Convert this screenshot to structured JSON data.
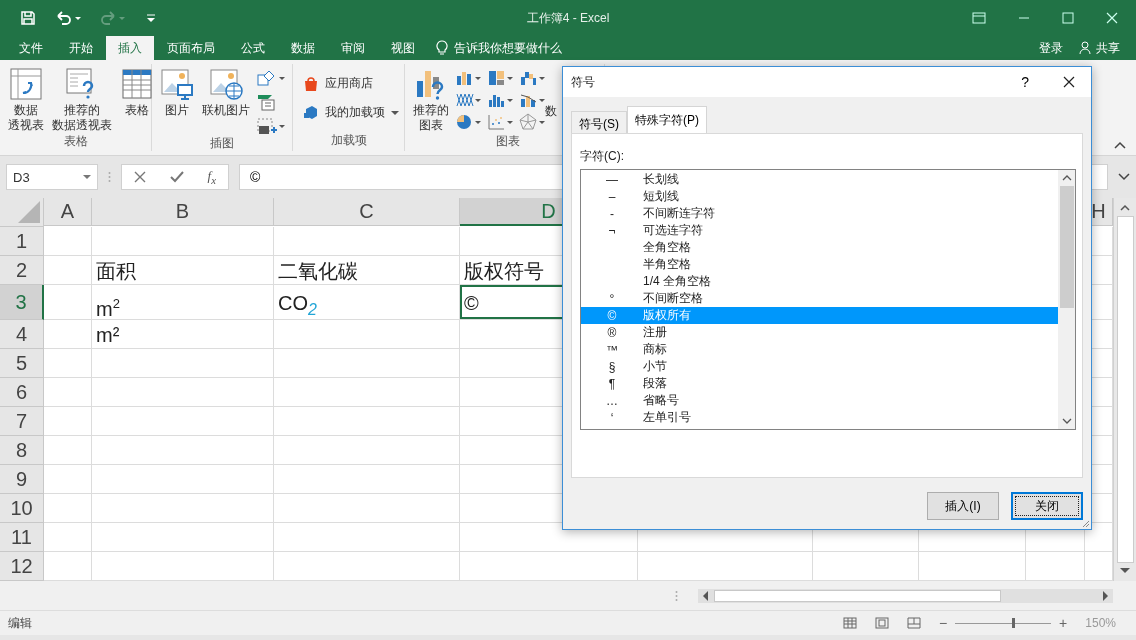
{
  "title_bar": {
    "title": "工作簿4 - Excel",
    "redo_disabled": true
  },
  "menu_tabs": [
    {
      "label": "文件",
      "selected": false
    },
    {
      "label": "开始",
      "selected": false
    },
    {
      "label": "插入",
      "selected": true
    },
    {
      "label": "页面布局",
      "selected": false
    },
    {
      "label": "公式",
      "selected": false
    },
    {
      "label": "数据",
      "selected": false
    },
    {
      "label": "审阅",
      "selected": false
    },
    {
      "label": "视图",
      "selected": false
    }
  ],
  "tell_me": "告诉我你想要做什么",
  "sign_in": "登录",
  "share": "共享",
  "ribbon_groups": [
    {
      "label": "表格",
      "items": [
        {
          "kind": "pivot",
          "lines": [
            "数据",
            "透视表"
          ]
        },
        {
          "kind": "recommended_pivot",
          "lines": [
            "推荐的",
            "数据透视表"
          ]
        },
        {
          "kind": "table",
          "lines": [
            "表格"
          ]
        }
      ]
    },
    {
      "label": "插图",
      "items": [
        {
          "kind": "picture",
          "lines": [
            "图片"
          ]
        },
        {
          "kind": "online_picture",
          "lines": [
            "联机图片"
          ]
        },
        {
          "kind": "small_illustrations"
        }
      ]
    },
    {
      "label": "加载项",
      "items": [
        {
          "kind": "addins",
          "store": "应用商店",
          "my_addins": "我的加载项"
        }
      ]
    },
    {
      "label": "图表",
      "items": [
        {
          "kind": "recommended_chart",
          "lines": [
            "推荐的",
            "图表"
          ]
        },
        {
          "kind": "chart_grid"
        },
        {
          "kind": "cut",
          "label": "数"
        }
      ]
    }
  ],
  "formula_bar": {
    "name_box": "D3",
    "function_button": "f$_{x}$",
    "formula": "©"
  },
  "sheet": {
    "columns": [
      {
        "label": "A",
        "selected": false
      },
      {
        "label": "B",
        "selected": false
      },
      {
        "label": "C",
        "selected": false
      },
      {
        "label": "D",
        "selected": true
      },
      {
        "label": "H",
        "selected": false
      }
    ],
    "rows": [
      {
        "header": "1",
        "selected": false
      },
      {
        "header": "2",
        "selected": false,
        "cells": [
          null,
          {
            "text": "面积",
            "active": false
          },
          {
            "text": "二氧化碳",
            "active": false
          },
          {
            "text": "版权符号",
            "active": false
          }
        ]
      },
      {
        "header": "3",
        "selected": true,
        "cells": [
          null,
          {
            "text": "m$^{2}$",
            "active": false
          },
          {
            "text": "CO$_{2}$",
            "active": false
          },
          {
            "text": "©",
            "active": true
          }
        ]
      },
      {
        "header": "4",
        "selected": false,
        "cells": [
          null,
          {
            "text": "m²",
            "active": false
          }
        ]
      },
      {
        "header": "5",
        "selected": false
      },
      {
        "header": "6",
        "selected": false
      },
      {
        "header": "7",
        "selected": false
      },
      {
        "header": "8",
        "selected": false
      },
      {
        "header": "9",
        "selected": false
      },
      {
        "header": "10",
        "selected": false
      },
      {
        "header": "11",
        "selected": false
      },
      {
        "header": "12",
        "selected": false
      }
    ]
  },
  "dialog": {
    "title": "符号",
    "help": "?",
    "tabs": [
      {
        "label": "符号(S)",
        "selected": false
      },
      {
        "label": "特殊字符(P)",
        "selected": true
      }
    ],
    "list_label": "字符(C):",
    "characters": [
      {
        "symbol": "—",
        "name": "长划线",
        "selected": false
      },
      {
        "symbol": "–",
        "name": "短划线",
        "selected": false
      },
      {
        "symbol": "‑",
        "name": "不间断连字符",
        "selected": false
      },
      {
        "symbol": "¬",
        "name": "可选连字符",
        "selected": false
      },
      {
        "name": "全角空格",
        "selected": false
      },
      {
        "name": "半角空格",
        "selected": false
      },
      {
        "name": "1/4 全角空格",
        "selected": false
      },
      {
        "symbol": "°",
        "name": "不间断空格",
        "selected": false
      },
      {
        "symbol": "©",
        "name": "版权所有",
        "selected": true
      },
      {
        "symbol": "®",
        "name": "注册",
        "selected": false
      },
      {
        "symbol": "™",
        "name": "商标",
        "selected": false
      },
      {
        "symbol": "§",
        "name": "小节",
        "selected": false
      },
      {
        "symbol": "¶",
        "name": "段落",
        "selected": false
      },
      {
        "symbol": "…",
        "name": "省略号",
        "selected": false
      },
      {
        "symbol": "‘",
        "name": "左单引号",
        "selected": false
      }
    ],
    "buttons": [
      {
        "label": "插入(I)",
        "default": false
      },
      {
        "label": "关闭",
        "default": true
      }
    ]
  },
  "status_bar": {
    "mode": "编辑",
    "zoom_out": "−",
    "zoom_slider": {
      "level": 0.6
    },
    "zoom_in": "+",
    "zoom": "150%"
  }
}
